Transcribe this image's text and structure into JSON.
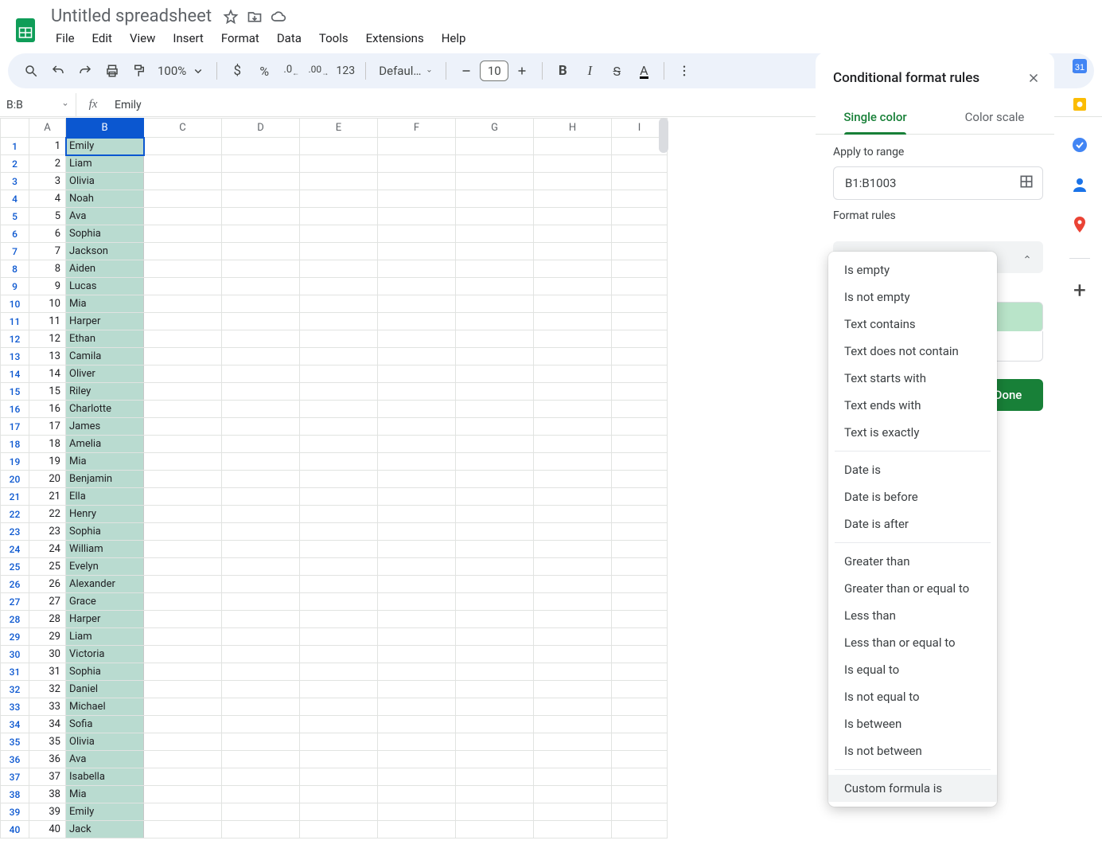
{
  "doc": {
    "title": "Untitled spreadsheet"
  },
  "menus": [
    "File",
    "Edit",
    "View",
    "Insert",
    "Format",
    "Data",
    "Tools",
    "Extensions",
    "Help"
  ],
  "toolbar": {
    "zoom": "100%",
    "font": "Defaul…",
    "font_size": "10",
    "currency": "$",
    "percent": "%",
    "dec_less": ".0",
    "dec_more": ".00",
    "num_fmt": "123"
  },
  "name_box": "B:B",
  "formula": "Emily",
  "columns": [
    "A",
    "B",
    "C",
    "D",
    "E",
    "F",
    "G",
    "H",
    "I"
  ],
  "rows": [
    {
      "n": 1,
      "a": "1",
      "b": "Emily"
    },
    {
      "n": 2,
      "a": "2",
      "b": "Liam"
    },
    {
      "n": 3,
      "a": "3",
      "b": "Olivia"
    },
    {
      "n": 4,
      "a": "4",
      "b": "Noah"
    },
    {
      "n": 5,
      "a": "5",
      "b": "Ava"
    },
    {
      "n": 6,
      "a": "6",
      "b": "Sophia"
    },
    {
      "n": 7,
      "a": "7",
      "b": "Jackson"
    },
    {
      "n": 8,
      "a": "8",
      "b": "Aiden"
    },
    {
      "n": 9,
      "a": "9",
      "b": "Lucas"
    },
    {
      "n": 10,
      "a": "10",
      "b": "Mia"
    },
    {
      "n": 11,
      "a": "11",
      "b": "Harper"
    },
    {
      "n": 12,
      "a": "12",
      "b": "Ethan"
    },
    {
      "n": 13,
      "a": "13",
      "b": "Camila"
    },
    {
      "n": 14,
      "a": "14",
      "b": "Oliver"
    },
    {
      "n": 15,
      "a": "15",
      "b": "Riley"
    },
    {
      "n": 16,
      "a": "16",
      "b": "Charlotte"
    },
    {
      "n": 17,
      "a": "17",
      "b": "James"
    },
    {
      "n": 18,
      "a": "18",
      "b": "Amelia"
    },
    {
      "n": 19,
      "a": "19",
      "b": "Mia"
    },
    {
      "n": 20,
      "a": "20",
      "b": "Benjamin"
    },
    {
      "n": 21,
      "a": "21",
      "b": "Ella"
    },
    {
      "n": 22,
      "a": "22",
      "b": "Henry"
    },
    {
      "n": 23,
      "a": "23",
      "b": "Sophia"
    },
    {
      "n": 24,
      "a": "24",
      "b": "William"
    },
    {
      "n": 25,
      "a": "25",
      "b": "Evelyn"
    },
    {
      "n": 26,
      "a": "26",
      "b": "Alexander"
    },
    {
      "n": 27,
      "a": "27",
      "b": "Grace"
    },
    {
      "n": 28,
      "a": "28",
      "b": "Harper"
    },
    {
      "n": 29,
      "a": "29",
      "b": "Liam"
    },
    {
      "n": 30,
      "a": "30",
      "b": "Victoria"
    },
    {
      "n": 31,
      "a": "31",
      "b": "Sophia"
    },
    {
      "n": 32,
      "a": "32",
      "b": "Daniel"
    },
    {
      "n": 33,
      "a": "33",
      "b": "Michael"
    },
    {
      "n": 34,
      "a": "34",
      "b": "Sofia"
    },
    {
      "n": 35,
      "a": "35",
      "b": "Olivia"
    },
    {
      "n": 36,
      "a": "36",
      "b": "Ava"
    },
    {
      "n": 37,
      "a": "37",
      "b": "Isabella"
    },
    {
      "n": 38,
      "a": "38",
      "b": "Mia"
    },
    {
      "n": 39,
      "a": "39",
      "b": "Emily"
    },
    {
      "n": 40,
      "a": "40",
      "b": "Jack"
    }
  ],
  "cf": {
    "title": "Conditional format rules",
    "tab_single": "Single color",
    "tab_scale": "Color scale",
    "apply_label": "Apply to range",
    "range": "B1:B1003",
    "rules_label": "Format rules",
    "done": "Done"
  },
  "dd_options": [
    {
      "t": "Is empty"
    },
    {
      "t": "Is not empty"
    },
    {
      "t": "Text contains"
    },
    {
      "t": "Text does not contain"
    },
    {
      "t": "Text starts with"
    },
    {
      "t": "Text ends with"
    },
    {
      "t": "Text is exactly"
    },
    {
      "sep": true
    },
    {
      "t": "Date is"
    },
    {
      "t": "Date is before"
    },
    {
      "t": "Date is after"
    },
    {
      "sep": true
    },
    {
      "t": "Greater than"
    },
    {
      "t": "Greater than or equal to"
    },
    {
      "t": "Less than"
    },
    {
      "t": "Less than or equal to"
    },
    {
      "t": "Is equal to"
    },
    {
      "t": "Is not equal to"
    },
    {
      "t": "Is between"
    },
    {
      "t": "Is not between"
    },
    {
      "sep": true
    },
    {
      "t": "Custom formula is",
      "hover": true
    }
  ]
}
